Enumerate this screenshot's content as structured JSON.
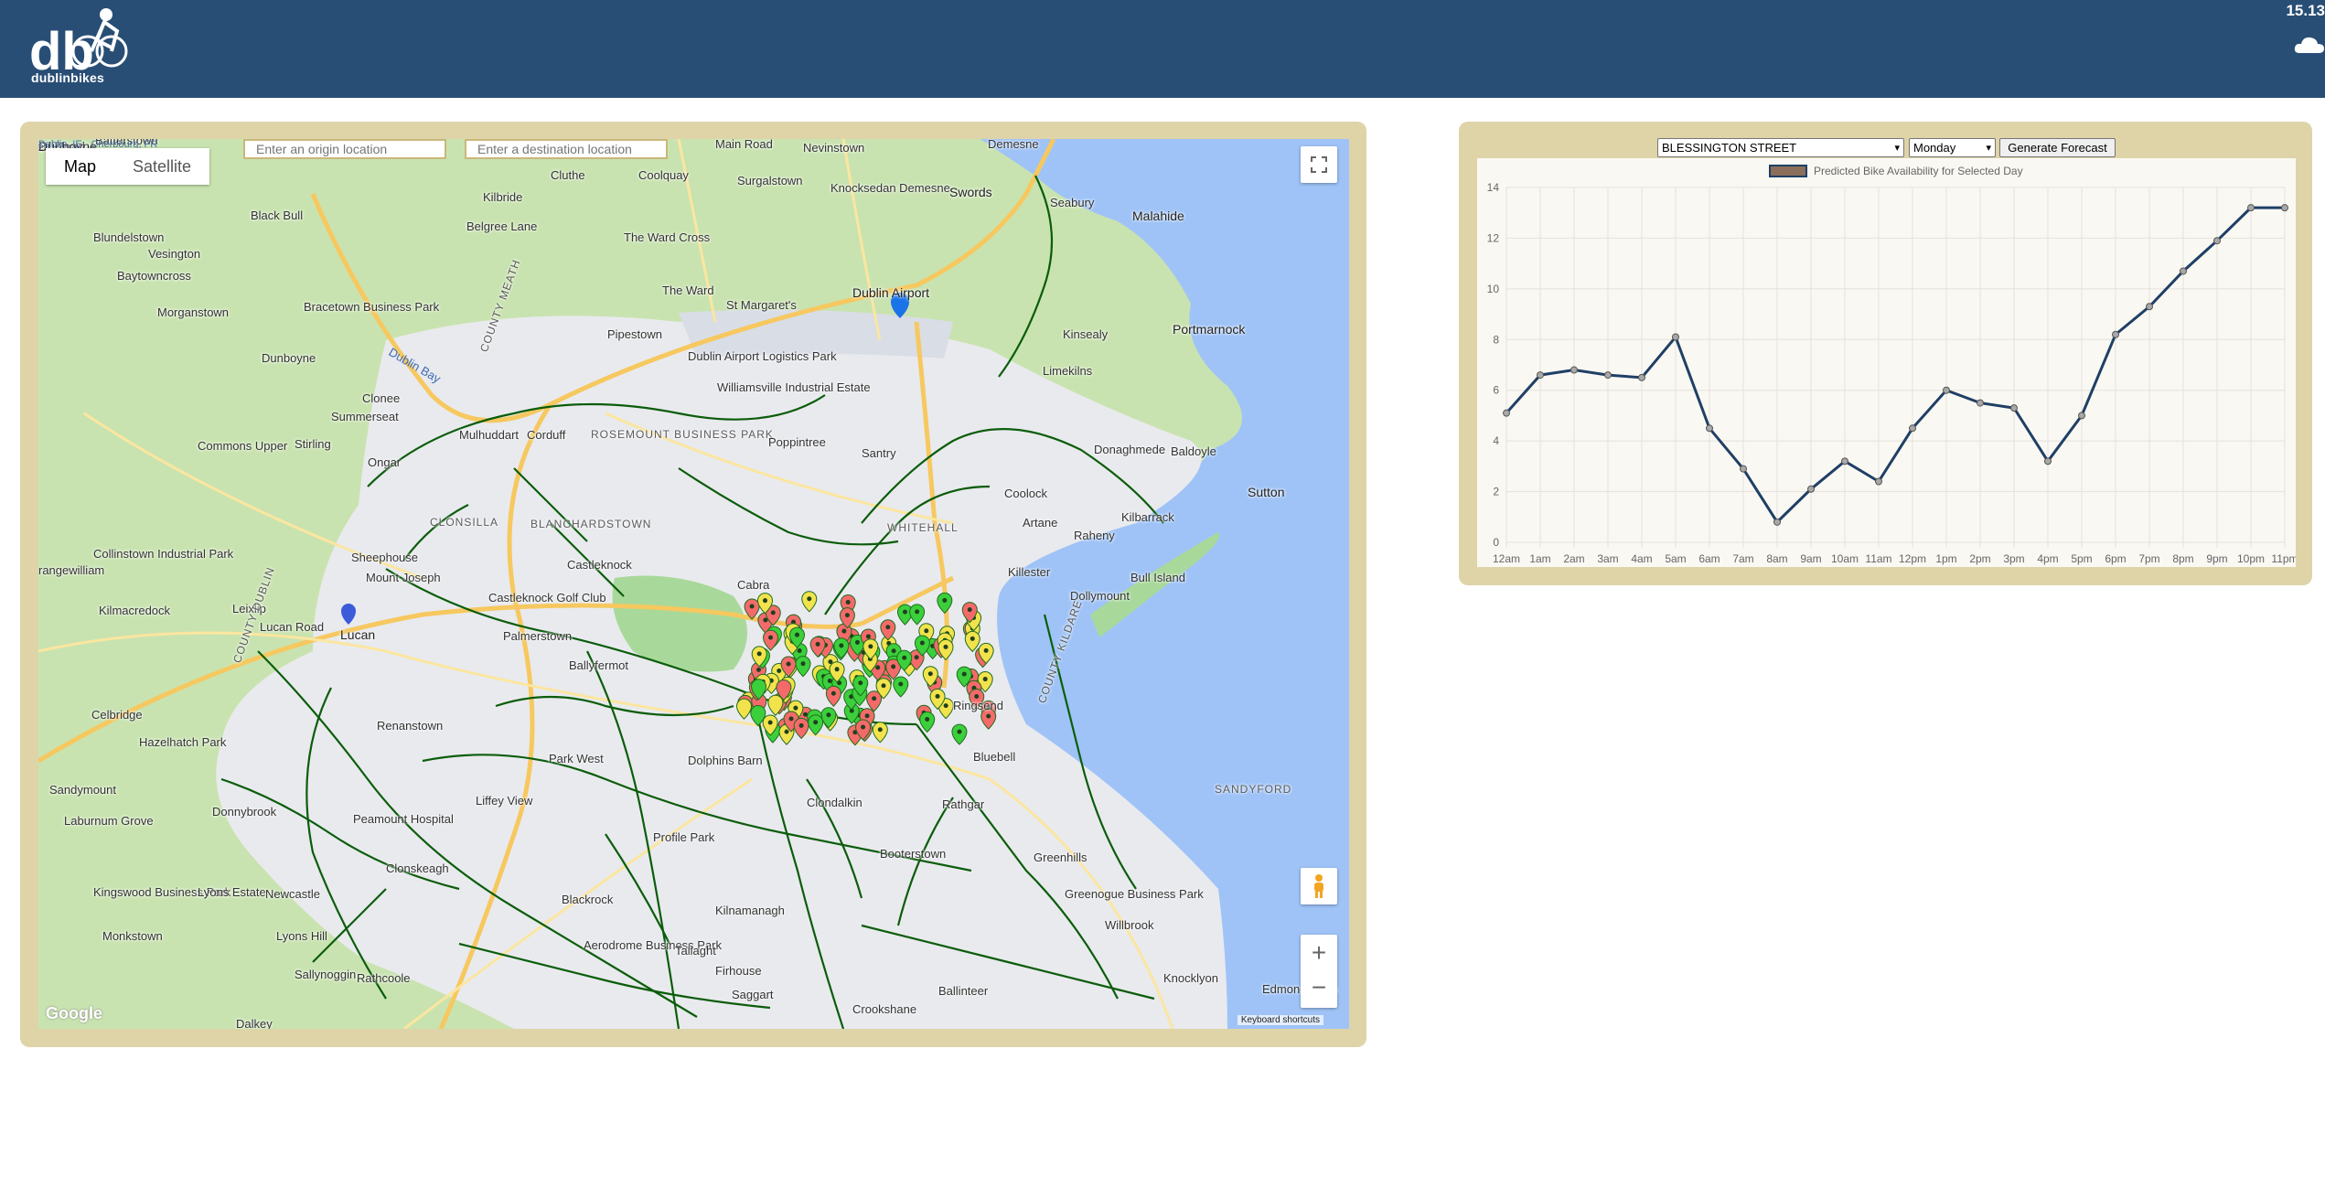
{
  "header": {
    "logo_text": "db",
    "logo_caption": "dublinbikes",
    "weather_temp": "15.13",
    "weather_icon": "cloud-icon"
  },
  "map": {
    "type_tabs": [
      {
        "label": "Map",
        "active": true
      },
      {
        "label": "Satellite",
        "active": false
      }
    ],
    "origin_placeholder": "Enter an origin location",
    "destination_placeholder": "Enter a destination location",
    "attribution": "Google",
    "keyboard_shortcuts": "Keyboard shortcuts",
    "zoom_in": "+",
    "zoom_out": "−",
    "labels": [
      {
        "text": "ed Road",
        "cls": "city"
      },
      {
        "text": "Batterstown",
        "cls": ""
      },
      {
        "text": "Dunboyne",
        "cls": "city"
      },
      {
        "text": "Main Road",
        "cls": ""
      },
      {
        "text": "Nevinstown",
        "cls": ""
      },
      {
        "text": "Demesne",
        "cls": ""
      },
      {
        "text": "Surgalstown",
        "cls": ""
      },
      {
        "text": "Cluthe",
        "cls": ""
      },
      {
        "text": "Coolquay",
        "cls": ""
      },
      {
        "text": "Kilbride",
        "cls": ""
      },
      {
        "text": "Knocksedan Demesne",
        "cls": ""
      },
      {
        "text": "Swords",
        "cls": "city"
      },
      {
        "text": "Seabury",
        "cls": ""
      },
      {
        "text": "Malahide",
        "cls": "city"
      },
      {
        "text": "Black Bull",
        "cls": ""
      },
      {
        "text": "Belgree Lane",
        "cls": ""
      },
      {
        "text": "The Ward Cross",
        "cls": ""
      },
      {
        "text": "Blundelstown",
        "cls": ""
      },
      {
        "text": "Vesington",
        "cls": ""
      },
      {
        "text": "Baytowncross",
        "cls": ""
      },
      {
        "text": "Bracetown Business Park",
        "cls": ""
      },
      {
        "text": "The Ward",
        "cls": ""
      },
      {
        "text": "St Margaret's",
        "cls": ""
      },
      {
        "text": "Dublin Airport",
        "cls": "city"
      },
      {
        "text": "Morganstown",
        "cls": ""
      },
      {
        "text": "Pipestown",
        "cls": ""
      },
      {
        "text": "Kinsealy",
        "cls": ""
      },
      {
        "text": "Portmarnock",
        "cls": "city"
      },
      {
        "text": "Dunboyne",
        "cls": ""
      },
      {
        "text": "Dublin Airport Logistics Park",
        "cls": ""
      },
      {
        "text": "Williamsville Industrial Estate",
        "cls": ""
      },
      {
        "text": "Limekilns",
        "cls": ""
      },
      {
        "text": "Clonee",
        "cls": ""
      },
      {
        "text": "Summerseat",
        "cls": ""
      },
      {
        "text": "Mulhuddart",
        "cls": ""
      },
      {
        "text": "Corduff",
        "cls": ""
      },
      {
        "text": "ROSEMOUNT BUSINESS PARK",
        "cls": "area"
      },
      {
        "text": "Poppintree",
        "cls": ""
      },
      {
        "text": "Santry",
        "cls": ""
      },
      {
        "text": "Donaghmede",
        "cls": ""
      },
      {
        "text": "Baldoyle",
        "cls": ""
      },
      {
        "text": "Commons Upper",
        "cls": ""
      },
      {
        "text": "Stirling",
        "cls": ""
      },
      {
        "text": "Ongar",
        "cls": ""
      },
      {
        "text": "Coolock",
        "cls": ""
      },
      {
        "text": "Artane",
        "cls": ""
      },
      {
        "text": "Raheny",
        "cls": ""
      },
      {
        "text": "Kilbarrack",
        "cls": ""
      },
      {
        "text": "Sutton",
        "cls": "city"
      },
      {
        "text": "CLONSILLA",
        "cls": "area"
      },
      {
        "text": "BLANCHARDSTOWN",
        "cls": "area"
      },
      {
        "text": "WHITEHALL",
        "cls": "area"
      },
      {
        "text": "Collinstown Industrial Park",
        "cls": ""
      },
      {
        "text": "Sheephouse",
        "cls": ""
      },
      {
        "text": "Castleknock",
        "cls": ""
      },
      {
        "text": "Killester",
        "cls": ""
      },
      {
        "text": "Bull Island",
        "cls": ""
      },
      {
        "text": "rangewilliam",
        "cls": ""
      },
      {
        "text": "Mount Joseph",
        "cls": ""
      },
      {
        "text": "Dollymount",
        "cls": ""
      },
      {
        "text": "Kilmacredock",
        "cls": ""
      },
      {
        "text": "Leixlip",
        "cls": ""
      },
      {
        "text": "Castleknock Golf Club",
        "cls": ""
      },
      {
        "text": "Cabra",
        "cls": ""
      },
      {
        "text": "Lucan Road",
        "cls": ""
      },
      {
        "text": "Lucan",
        "cls": "city"
      },
      {
        "text": "Palmerstown",
        "cls": ""
      },
      {
        "text": "Celbridge",
        "cls": ""
      },
      {
        "text": "Ballyfermot",
        "cls": ""
      },
      {
        "text": "Ringsend",
        "cls": ""
      },
      {
        "text": "Renanstown",
        "cls": ""
      },
      {
        "text": "Hazelhatch Park",
        "cls": ""
      },
      {
        "text": "Park West",
        "cls": ""
      },
      {
        "text": "Dolphins Barn",
        "cls": ""
      },
      {
        "text": "Bluebell",
        "cls": ""
      },
      {
        "text": "Sandymount",
        "cls": ""
      },
      {
        "text": "Laburnum Grove",
        "cls": ""
      },
      {
        "text": "Liffey View",
        "cls": ""
      },
      {
        "text": "Clondalkin",
        "cls": ""
      },
      {
        "text": "Rathgar",
        "cls": ""
      },
      {
        "text": "Donnybrook",
        "cls": ""
      },
      {
        "text": "Peamount Hospital",
        "cls": ""
      },
      {
        "text": "Profile Park",
        "cls": ""
      },
      {
        "text": "Greenhills",
        "cls": ""
      },
      {
        "text": "Booterstown",
        "cls": ""
      },
      {
        "text": "Clonskeagh",
        "cls": ""
      },
      {
        "text": "Kingswood Business Park",
        "cls": ""
      },
      {
        "text": "Lyons Estate",
        "cls": ""
      },
      {
        "text": "Newcastle",
        "cls": ""
      },
      {
        "text": "Greenogue Business Park",
        "cls": ""
      },
      {
        "text": "Blackrock",
        "cls": ""
      },
      {
        "text": "Kilnamanagh",
        "cls": ""
      },
      {
        "text": "Willbrook",
        "cls": ""
      },
      {
        "text": "Monkstown",
        "cls": ""
      },
      {
        "text": "Lyons Hill",
        "cls": ""
      },
      {
        "text": "Aerodrome Business Park",
        "cls": ""
      },
      {
        "text": "Tallaght",
        "cls": ""
      },
      {
        "text": "Firhouse",
        "cls": ""
      },
      {
        "text": "Knocklyon",
        "cls": ""
      },
      {
        "text": "Sallynoggin",
        "cls": ""
      },
      {
        "text": "Rathcoole",
        "cls": ""
      },
      {
        "text": "Saggart",
        "cls": ""
      },
      {
        "text": "Edmondstown",
        "cls": ""
      },
      {
        "text": "Dalkey",
        "cls": ""
      },
      {
        "text": "Crookshane",
        "cls": ""
      },
      {
        "text": "Ballinteer",
        "cls": ""
      },
      {
        "text": "SANDYFORD",
        "cls": "area"
      },
      {
        "text": "Dublin Bay",
        "cls": ""
      },
      {
        "text": "COUNTY MEATH",
        "cls": "area"
      },
      {
        "text": "COUNTY DUBLIN",
        "cls": "area"
      },
      {
        "text": "COUNTY KILDARE",
        "cls": "area"
      },
      {
        "text": "Dublin, IE - Cherbourg, FR",
        "cls": ""
      }
    ]
  },
  "forecast": {
    "station": "BLESSINGTON STREET",
    "day": "Monday",
    "button_label": "Generate Forecast",
    "legend_color": "#8b6f5a"
  },
  "chart_data": {
    "type": "line",
    "title": "",
    "series": [
      {
        "name": "Predicted Bike Availability for Selected Day",
        "color": "#1f3f66",
        "values": [
          5.1,
          6.6,
          6.8,
          6.6,
          6.5,
          8.1,
          4.5,
          2.9,
          0.8,
          2.1,
          3.2,
          2.4,
          4.5,
          6.0,
          5.5,
          5.3,
          3.2,
          5.0,
          8.2,
          9.3,
          10.7,
          11.9,
          13.2,
          13.2
        ]
      }
    ],
    "categories": [
      "12am",
      "1am",
      "2am",
      "3am",
      "4am",
      "5am",
      "6am",
      "7am",
      "8am",
      "9am",
      "10am",
      "11am",
      "12pm",
      "1pm",
      "2pm",
      "3pm",
      "4pm",
      "5pm",
      "6pm",
      "7pm",
      "8pm",
      "9pm",
      "10pm",
      "11pm"
    ],
    "yticks": [
      "0",
      "2",
      "4",
      "6",
      "8",
      "10",
      "12",
      "14"
    ],
    "ylim": [
      0,
      14
    ],
    "grid": true,
    "legend": "top-center"
  }
}
